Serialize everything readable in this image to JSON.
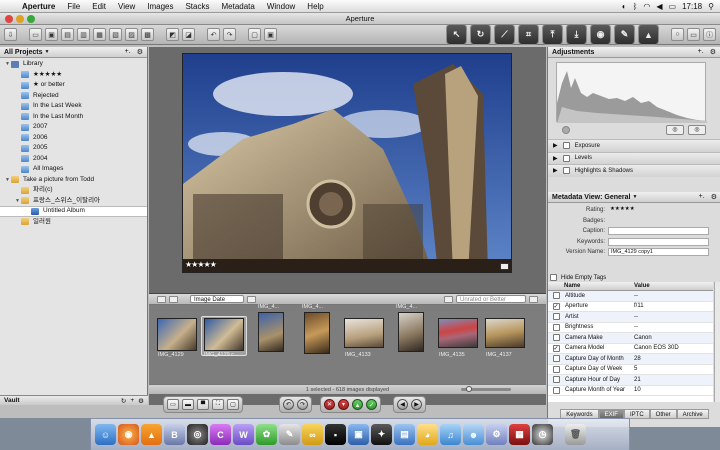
{
  "menubar": {
    "app_name": "Aperture",
    "items": [
      "File",
      "Edit",
      "View",
      "Images",
      "Stacks",
      "Metadata",
      "Window",
      "Help"
    ],
    "clock": "17:18"
  },
  "window": {
    "title": "Aperture"
  },
  "projects": {
    "header": "All Projects",
    "items": [
      {
        "label": "Library",
        "type": "lib",
        "level": 0,
        "open": true
      },
      {
        "label": "★★★★★",
        "type": "blue",
        "level": 1
      },
      {
        "label": "★ or better",
        "type": "blue",
        "level": 1
      },
      {
        "label": "Rejected",
        "type": "blue",
        "level": 1
      },
      {
        "label": "In the Last Week",
        "type": "blue",
        "level": 1
      },
      {
        "label": "In the Last Month",
        "type": "blue",
        "level": 1
      },
      {
        "label": "2007",
        "type": "blue",
        "level": 1
      },
      {
        "label": "2006",
        "type": "blue",
        "level": 1
      },
      {
        "label": "2005",
        "type": "blue",
        "level": 1
      },
      {
        "label": "2004",
        "type": "blue",
        "level": 1
      },
      {
        "label": "All Images",
        "type": "blue",
        "level": 1
      },
      {
        "label": "Take a picture from Todd",
        "type": "fold",
        "level": 0,
        "open": true
      },
      {
        "label": "파리(c)",
        "type": "fold",
        "level": 1
      },
      {
        "label": "프랑스_스위스_이탈리아",
        "type": "fold",
        "level": 1,
        "open": true
      },
      {
        "label": "Untitled Album",
        "type": "alb",
        "level": 2,
        "selected": true
      },
      {
        "label": "일러원",
        "type": "fold",
        "level": 1
      }
    ],
    "footer": "Vault"
  },
  "viewer": {
    "rating": "★★★★★"
  },
  "browser": {
    "sort": "Image Date",
    "filter_placeholder": "Unrated or Better",
    "thumbs": [
      {
        "label": "IMG_4129",
        "pos": "bot"
      },
      {
        "label": "IMG_4129 c...",
        "pos": "bot",
        "selected": true
      },
      {
        "label": "IMG_4...",
        "pos": "top"
      },
      {
        "label": "IMG_4...",
        "pos": "top"
      },
      {
        "label": "IMG_4133",
        "pos": "bot"
      },
      {
        "label": "IMG_4...",
        "pos": "top"
      },
      {
        "label": "IMG_4135",
        "pos": "bot"
      },
      {
        "label": "IMG_4137",
        "pos": "bot"
      }
    ],
    "status": "1 selected - 618 images displayed"
  },
  "adjustments": {
    "title": "Adjustments",
    "rows": [
      "Exposure",
      "Levels",
      "Highlights & Shadows"
    ]
  },
  "metadata": {
    "view": "Metadata View: General",
    "fields": [
      {
        "k": "Rating:",
        "v": "★★★★★",
        "plain": true
      },
      {
        "k": "Badges:",
        "v": "",
        "plain": true
      },
      {
        "k": "Caption:",
        "v": ""
      },
      {
        "k": "Keywords:",
        "v": ""
      },
      {
        "k": "Version Name:",
        "v": "IMG_4129 copy1"
      }
    ],
    "hide_empty": "Hide Empty Tags",
    "col_name": "Name",
    "col_value": "Value",
    "rows": [
      {
        "n": "Altitude",
        "v": "--",
        "chk": false
      },
      {
        "n": "Aperture",
        "v": "f/11",
        "chk": true
      },
      {
        "n": "Artist",
        "v": "--",
        "chk": false
      },
      {
        "n": "Brightness",
        "v": "--",
        "chk": false
      },
      {
        "n": "Camera Make",
        "v": "Canon",
        "chk": false
      },
      {
        "n": "Camera Model",
        "v": "Canon EOS 30D",
        "chk": true
      },
      {
        "n": "Capture Day of Month",
        "v": "28",
        "chk": false
      },
      {
        "n": "Capture Day of Week",
        "v": "5",
        "chk": false
      },
      {
        "n": "Capture Hour of Day",
        "v": "21",
        "chk": false
      },
      {
        "n": "Capture Month of Year",
        "v": "10",
        "chk": false
      }
    ],
    "tabs": [
      "Keywords",
      "EXIF",
      "IPTC",
      "Other",
      "Archive"
    ]
  }
}
